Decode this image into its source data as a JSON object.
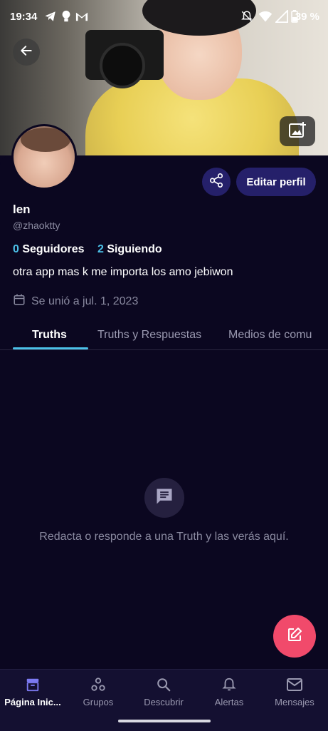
{
  "status_bar": {
    "time": "19:34",
    "battery": "39 %",
    "icons": [
      "telegram-icon",
      "lightbulb-icon",
      "gmail-icon",
      "mute-icon",
      "wifi-icon",
      "signal-icon",
      "battery-icon"
    ]
  },
  "header": {
    "back_icon": "arrow-left-icon",
    "edit_banner_icon": "add-photo-icon"
  },
  "profile": {
    "name": "len",
    "handle": "@zhaoktty",
    "followers_count": "0",
    "followers_label": "Seguidores",
    "following_count": "2",
    "following_label": "Siguiendo",
    "bio": "otra app mas k me importa los amo jebiwon",
    "joined": "Se unió a jul. 1, 2023",
    "edit_label": "Editar perfil"
  },
  "tabs": [
    {
      "label": "Truths",
      "active": true
    },
    {
      "label": "Truths y Respuestas",
      "active": false
    },
    {
      "label": "Medios de comu",
      "active": false
    }
  ],
  "empty_state": {
    "message": "Redacta o responde a una Truth y las verás aquí."
  },
  "bottom_nav": [
    {
      "label": "Página Inic...",
      "icon": "home-icon",
      "active": true
    },
    {
      "label": "Grupos",
      "icon": "groups-icon",
      "active": false
    },
    {
      "label": "Descubrir",
      "icon": "search-icon",
      "active": false
    },
    {
      "label": "Alertas",
      "icon": "bell-icon",
      "active": false
    },
    {
      "label": "Mensajes",
      "icon": "mail-icon",
      "active": false
    }
  ],
  "colors": {
    "background": "#0b0720",
    "accent": "#4cc1e8",
    "button": "#25206a",
    "fab": "#f14a6b"
  }
}
